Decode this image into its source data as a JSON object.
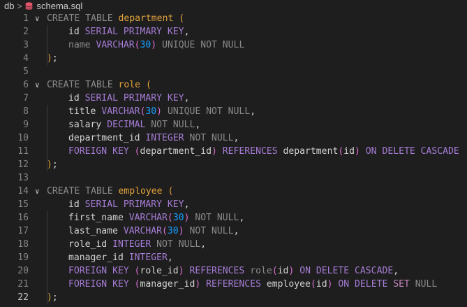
{
  "breadcrumb": {
    "folder": "db",
    "file": "schema.sql"
  },
  "lines": [
    {
      "n": "1",
      "fold": true,
      "ind": false,
      "html": "<span class='dim'>CREATE TABLE</span> <span class='org'>department</span> <span class='org'>(</span>"
    },
    {
      "n": "2",
      "ind": true,
      "html": "<span class='txt'>id</span> <span class='sqlkw'>SERIAL PRIMARY KEY</span><span class='txt'>,</span>"
    },
    {
      "n": "3",
      "ind": true,
      "html": "<span class='dim'>name</span> <span class='sqlkw'>VARCHAR</span><span class='ppar'>(</span><span class='bpar'>30</span><span class='ppar'>)</span> <span class='dim'>UNIQUE NOT NULL</span>"
    },
    {
      "n": "4",
      "ind": false,
      "html": "<span class='org'>)</span><span class='txt'>;</span>"
    },
    {
      "n": "5",
      "ind": false,
      "html": ""
    },
    {
      "n": "6",
      "fold": true,
      "ind": false,
      "html": "<span class='dim'>CREATE TABLE</span> <span class='org'>role</span> <span class='org'>(</span>"
    },
    {
      "n": "7",
      "ind": true,
      "html": "<span class='txt'>id</span> <span class='sqlkw'>SERIAL PRIMARY KEY</span><span class='txt'>,</span>"
    },
    {
      "n": "8",
      "ind": true,
      "html": "<span class='txt'>title</span> <span class='sqlkw'>VARCHAR</span><span class='ppar'>(</span><span class='bpar'>30</span><span class='ppar'>)</span> <span class='dim'>UNIQUE NOT NULL</span><span class='txt'>,</span>"
    },
    {
      "n": "9",
      "ind": true,
      "html": "<span class='txt'>salary</span> <span class='sqlkw'>DECIMAL</span> <span class='dim'>NOT NULL</span><span class='txt'>,</span>"
    },
    {
      "n": "10",
      "ind": true,
      "html": "<span class='txt'>department_id</span> <span class='sqlkw'>INTEGER</span> <span class='dim'>NOT NULL</span><span class='txt'>,</span>"
    },
    {
      "n": "11",
      "ind": true,
      "html": "<span class='sqlkw'>FOREIGN KEY</span> <span class='ppar'>(</span><span class='txt'>department_id</span><span class='ppar'>)</span> <span class='sqlkw'>REFERENCES</span> <span class='txt'>department</span><span class='ppar'>(</span><span class='txt'>id</span><span class='ppar'>)</span> <span class='sqlkw'>ON DELETE CASCADE</span>"
    },
    {
      "n": "12",
      "ind": false,
      "html": "<span class='org'>)</span><span class='txt'>;</span>"
    },
    {
      "n": "13",
      "ind": false,
      "html": ""
    },
    {
      "n": "14",
      "fold": true,
      "ind": false,
      "html": "<span class='dim'>CREATE TABLE</span> <span class='org'>employee</span> <span class='org'>(</span>"
    },
    {
      "n": "15",
      "ind": true,
      "html": "<span class='txt'>id</span> <span class='sqlkw'>SERIAL PRIMARY KEY</span><span class='txt'>,</span>"
    },
    {
      "n": "16",
      "ind": true,
      "html": "<span class='txt'>first_name</span> <span class='sqlkw'>VARCHAR</span><span class='ppar'>(</span><span class='bpar'>30</span><span class='ppar'>)</span> <span class='dim'>NOT NULL</span><span class='txt'>,</span>"
    },
    {
      "n": "17",
      "ind": true,
      "html": "<span class='txt'>last_name</span> <span class='sqlkw'>VARCHAR</span><span class='ppar'>(</span><span class='bpar'>30</span><span class='ppar'>)</span> <span class='dim'>NOT NULL</span><span class='txt'>,</span>"
    },
    {
      "n": "18",
      "ind": true,
      "html": "<span class='txt'>role_id</span> <span class='sqlkw'>INTEGER</span> <span class='dim'>NOT NULL</span><span class='txt'>,</span>"
    },
    {
      "n": "19",
      "ind": true,
      "html": "<span class='txt'>manager_id</span> <span class='sqlkw'>INTEGER</span><span class='txt'>,</span>"
    },
    {
      "n": "20",
      "ind": true,
      "html": "<span class='sqlkw'>FOREIGN KEY</span> <span class='ppar'>(</span><span class='txt'>role_id</span><span class='ppar'>)</span> <span class='sqlkw'>REFERENCES</span> <span class='dim'>role</span><span class='ppar'>(</span><span class='txt'>id</span><span class='ppar'>)</span> <span class='sqlkw'>ON DELETE CASCADE</span><span class='txt'>,</span>"
    },
    {
      "n": "21",
      "ind": true,
      "html": "<span class='sqlkw'>FOREIGN KEY</span> <span class='ppar'>(</span><span class='txt'>manager_id</span><span class='ppar'>)</span> <span class='sqlkw'>REFERENCES</span> <span class='txt'>employee</span><span class='ppar'>(</span><span class='txt'>id</span><span class='ppar'>)</span> <span class='sqlkw'>ON DELETE</span> <span class='kw2'>SET</span> <span class='dim'>NULL</span>"
    },
    {
      "n": "22",
      "ind": false,
      "active": true,
      "html": "<span class='org'>)</span><span class='txt'>;</span>"
    }
  ]
}
